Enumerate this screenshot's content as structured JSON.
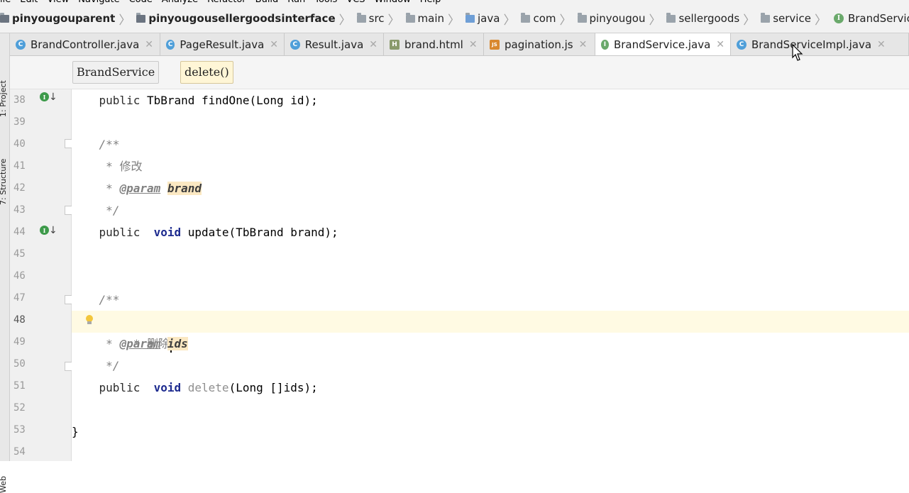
{
  "menu": [
    "ile",
    "Edit",
    "View",
    "Navigate",
    "Code",
    "Analyze",
    "Refactor",
    "Build",
    "Run",
    "Tools",
    "VCS",
    "Window",
    "Help"
  ],
  "breadcrumb": [
    {
      "label": "pinyougouparent",
      "bold": true,
      "icon": "module-folder-icon"
    },
    {
      "label": "pinyougousellergoodsinterface",
      "bold": true,
      "icon": "module-folder-icon"
    },
    {
      "label": "src",
      "bold": false,
      "icon": "folder-icon"
    },
    {
      "label": "main",
      "bold": false,
      "icon": "folder-icon"
    },
    {
      "label": "java",
      "bold": false,
      "icon": "source-folder-icon"
    },
    {
      "label": "com",
      "bold": false,
      "icon": "package-icon"
    },
    {
      "label": "pinyougou",
      "bold": false,
      "icon": "package-icon"
    },
    {
      "label": "sellergoods",
      "bold": false,
      "icon": "package-icon"
    },
    {
      "label": "service",
      "bold": false,
      "icon": "package-icon"
    },
    {
      "label": "BrandService",
      "bold": false,
      "icon": "interface-icon"
    }
  ],
  "side_tools": {
    "project": "1: Project",
    "structure": "7: Structure",
    "web": "Web"
  },
  "tabs": [
    {
      "label": "BrandController.java",
      "type": "class",
      "glyph": "C",
      "active": false
    },
    {
      "label": "PageResult.java",
      "type": "class",
      "glyph": "C",
      "active": false
    },
    {
      "label": "Result.java",
      "type": "class",
      "glyph": "C",
      "active": false
    },
    {
      "label": "brand.html",
      "type": "html",
      "glyph": "H",
      "active": false
    },
    {
      "label": "pagination.js",
      "type": "js",
      "glyph": "JS",
      "active": false
    },
    {
      "label": "BrandService.java",
      "type": "iface",
      "glyph": "I",
      "active": true
    },
    {
      "label": "BrandServiceImpl.java",
      "type": "class",
      "glyph": "C",
      "active": false
    }
  ],
  "editor_breadcrumb": {
    "class_name": "BrandService",
    "method": "delete()"
  },
  "colors": {
    "accent_class": "#4f9fd9",
    "accent_interface": "#6aa96b",
    "current_line": "#fffae3",
    "keyword": "#1d2b8f",
    "param_highlight": "#fbe8c2"
  },
  "code": {
    "line_numbers": [
      "38",
      "39",
      "40",
      "41",
      "42",
      "43",
      "44",
      "45",
      "46",
      "47",
      "48",
      "49",
      "50",
      "51",
      "52",
      "53",
      "54"
    ],
    "l38": {
      "kw": "public",
      "rest": " TbBrand findOne(Long id);"
    },
    "l40": "/**",
    "l41": "* 修改",
    "l42": {
      "tag": "@param",
      "param": "brand"
    },
    "l43": "*/",
    "l44": {
      "kw": "public",
      "kw2": "void",
      "rest": " update(TbBrand brand);"
    },
    "l47": "/**",
    "l48": "* 删除",
    "l49": {
      "tag": "@param",
      "param": "ids"
    },
    "l50": "*/",
    "l51": {
      "kw": "public",
      "kw2": "void",
      "name": "delete",
      "rest": "(Long []ids);"
    },
    "l53": "}"
  }
}
